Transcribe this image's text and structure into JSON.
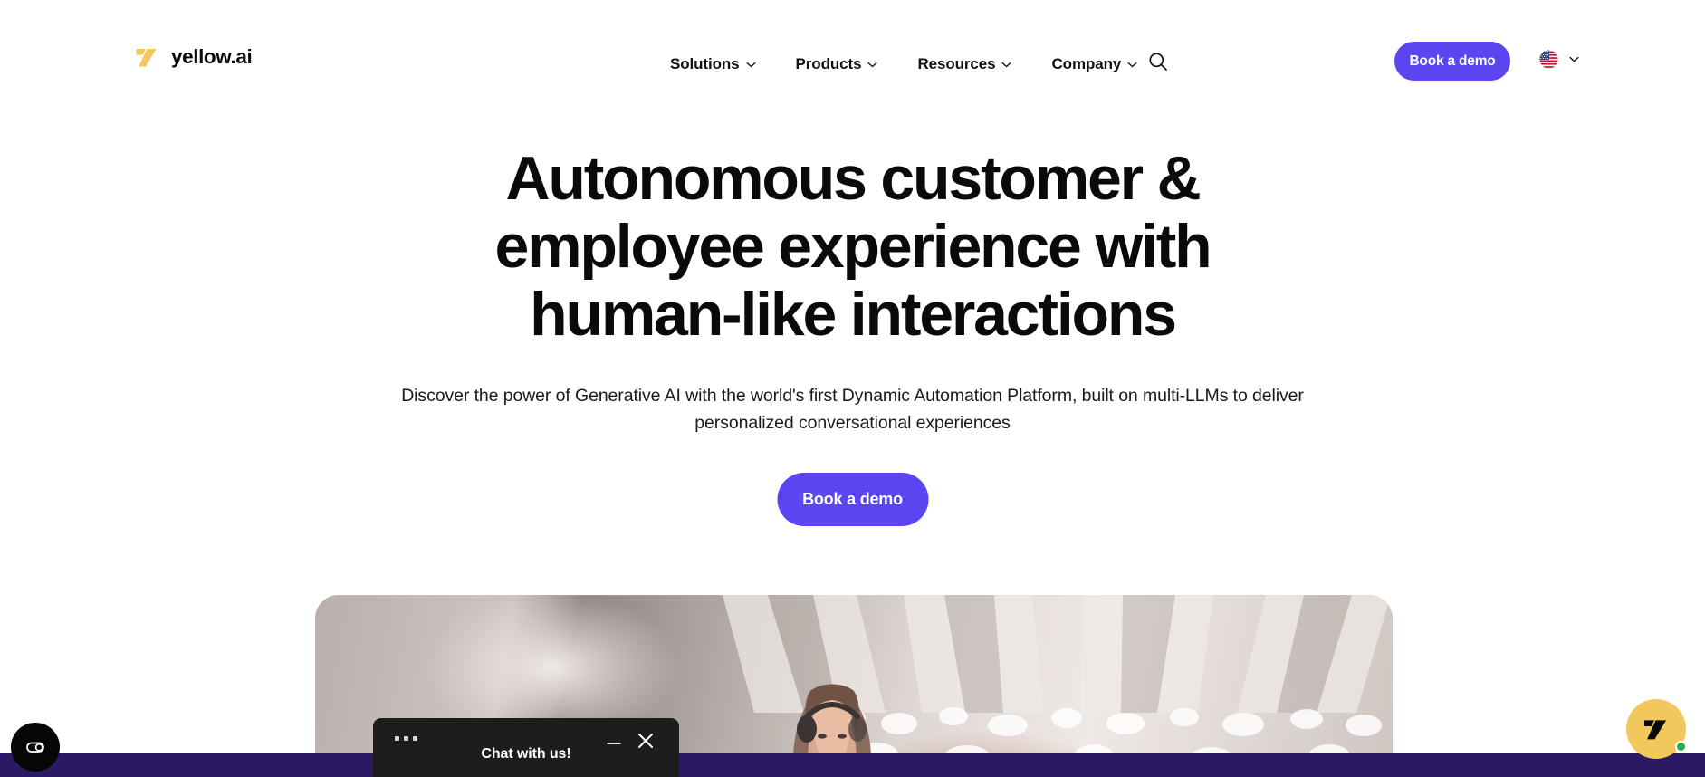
{
  "header": {
    "logo": {
      "mark": "yellow-chevron-logo",
      "text": "yellow.ai"
    },
    "nav_items": [
      {
        "label": "Solutions",
        "has_dropdown": true
      },
      {
        "label": "Products",
        "has_dropdown": true
      },
      {
        "label": "Resources",
        "has_dropdown": true
      },
      {
        "label": "Company",
        "has_dropdown": true
      }
    ],
    "search_icon": "search-icon",
    "cta_label": "Book a demo",
    "language": {
      "flag": "us-flag-icon",
      "chevron": "chevron-down-icon"
    }
  },
  "hero": {
    "headline_lines": [
      "Autonomous customer &",
      "employee experience with",
      "human-like interactions"
    ],
    "subheadline": "Discover the power of Generative AI with the world's first Dynamic Automation Platform, built on multi-LLMs to deliver personalized conversational experiences",
    "cta_label": "Book a demo"
  },
  "chat_popup": {
    "title": "Chat with us!",
    "menu_icon": "ellipsis-icon",
    "minimize_icon": "minimize-icon",
    "close_icon": "close-icon"
  },
  "widgets": {
    "accessibility_icon": "accessibility-toggle-icon",
    "chat_launcher_icon": "yellow-ai-logo-icon",
    "chat_online_status": "online"
  },
  "colors": {
    "brand_purple": "#5a45f0",
    "band_purple": "#2a1a63",
    "brand_yellow": "#f2c75c",
    "text_dark": "#0a0a0a",
    "chat_dark": "#1d1d1d",
    "online_green": "#2aa84a"
  }
}
